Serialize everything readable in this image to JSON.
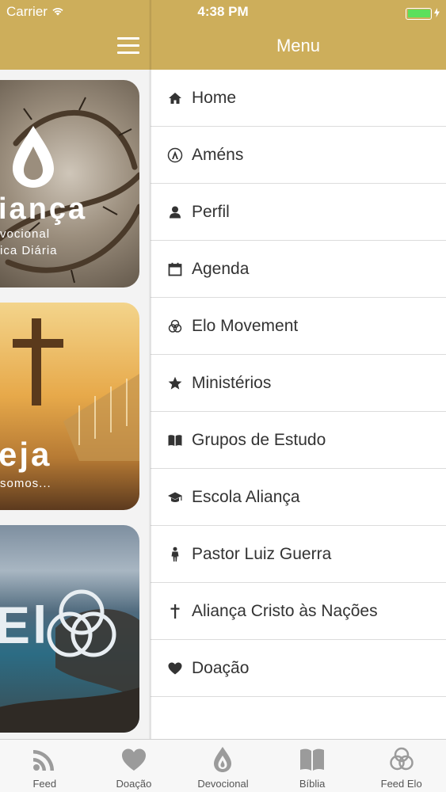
{
  "status_bar": {
    "carrier": "Carrier",
    "time": "4:38 PM",
    "battery_color": "#5ce05c"
  },
  "left_pane": {
    "cards": [
      {
        "title": "iança",
        "subtitle_line1": "vocional",
        "subtitle_line2": "ica Diária",
        "image": "crown-of-thorns-photo"
      },
      {
        "title": "eja",
        "subtitle_line1": "somos...",
        "image": "cross-sunset-photo"
      },
      {
        "title": "El",
        "image": "ocean-rocks-photo"
      }
    ]
  },
  "menu": {
    "header_color": "#cdae5b",
    "title": "Menu",
    "items": [
      {
        "label": "Home",
        "icon": "home-icon"
      },
      {
        "label": "Améns",
        "icon": "amens-icon"
      },
      {
        "label": "Perfil",
        "icon": "user-icon"
      },
      {
        "label": "Agenda",
        "icon": "calendar-icon"
      },
      {
        "label": "Elo Movement",
        "icon": "rings-icon"
      },
      {
        "label": "Ministérios",
        "icon": "star-icon"
      },
      {
        "label": "Grupos de Estudo",
        "icon": "book-icon"
      },
      {
        "label": "Escola Aliança",
        "icon": "graduation-cap-icon"
      },
      {
        "label": "Pastor Luiz Guerra",
        "icon": "person-icon"
      },
      {
        "label": "Aliança Cristo às Nações",
        "icon": "cross-icon"
      },
      {
        "label": "Doação",
        "icon": "heart-icon"
      }
    ]
  },
  "tabbar": {
    "tabs": [
      {
        "label": "Feed",
        "icon": "rss-icon"
      },
      {
        "label": "Doação",
        "icon": "heart-icon"
      },
      {
        "label": "Devocional",
        "icon": "flame-drop-icon"
      },
      {
        "label": "Bíblia",
        "icon": "bible-book-icon"
      },
      {
        "label": "Feed Elo",
        "icon": "rings-icon"
      }
    ]
  }
}
